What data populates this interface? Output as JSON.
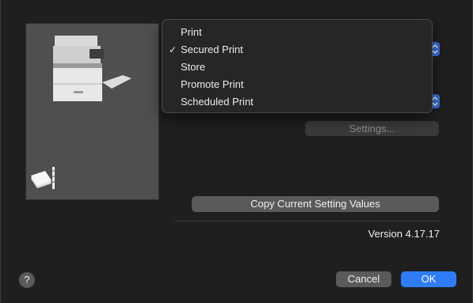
{
  "menu": {
    "items": [
      {
        "label": "Print",
        "checked": false
      },
      {
        "label": "Secured Print",
        "checked": true
      },
      {
        "label": "Store",
        "checked": false
      },
      {
        "label": "Promote Print",
        "checked": false
      },
      {
        "label": "Scheduled Print",
        "checked": false
      }
    ],
    "check_glyph": "✓"
  },
  "buttons": {
    "settings_label": "Settings...",
    "copy_label": "Copy Current Setting Values",
    "help_label": "?",
    "cancel_label": "Cancel",
    "ok_label": "OK"
  },
  "version_text": "Version 4.17.17",
  "colors": {
    "accent": "#2f7cf6",
    "popup": "#3a6fd8"
  },
  "icons": {
    "printer": "printer-icon",
    "paper_stack": "paper-stack-icon",
    "popup_arrows": "chevron-updown-icon"
  }
}
